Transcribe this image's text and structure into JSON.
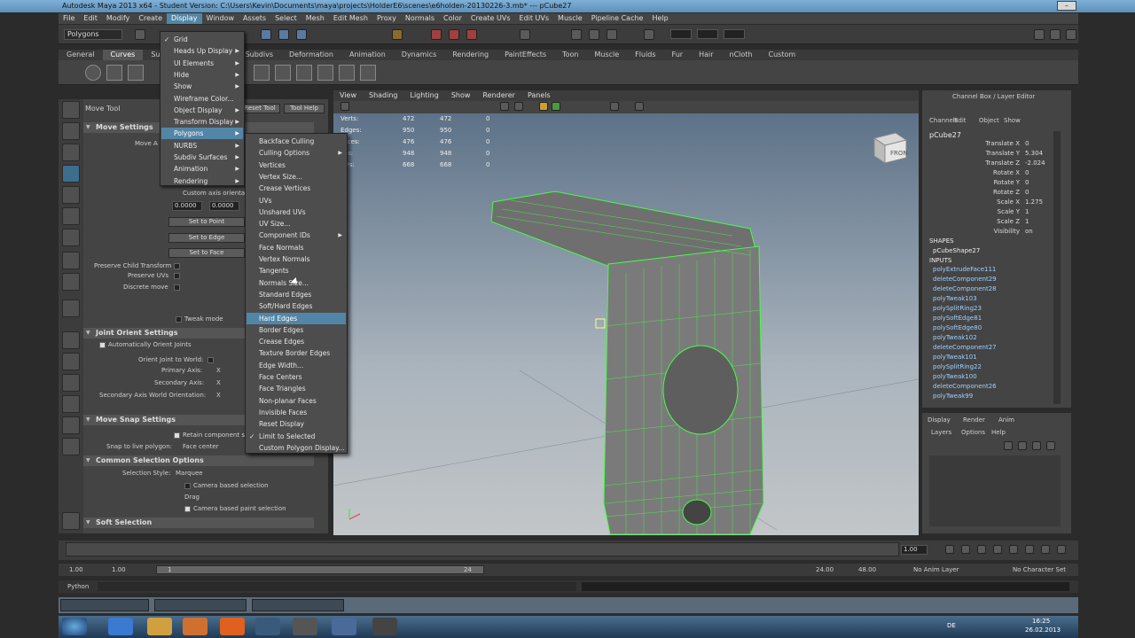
{
  "window": {
    "title": "Autodesk Maya 2013 x64 - Student Version: C:\\Users\\Kevin\\Documents\\maya\\projects\\HolderE6\\scenes\\e6holden-20130226-3.mb* --- pCube27"
  },
  "menubar": [
    "File",
    "Edit",
    "Modify",
    "Create",
    "Display",
    "Window",
    "Assets",
    "Select",
    "Mesh",
    "Edit Mesh",
    "Proxy",
    "Normals",
    "Color",
    "Create UVs",
    "Edit UVs",
    "Muscle",
    "Pipeline Cache",
    "Help"
  ],
  "statusline": {
    "mode": "Polygons"
  },
  "shelf_tabs": [
    "General",
    "Curves",
    "Surfaces",
    "Polygons",
    "Subdivs",
    "Deformation",
    "Animation",
    "Dynamics",
    "Rendering",
    "PaintEffects",
    "Toon",
    "Muscle",
    "Fluids",
    "Fur",
    "Hair",
    "nCloth",
    "Custom"
  ],
  "tool_settings": {
    "title": "Move Tool",
    "tab_reset": "Reset Tool",
    "tab_help": "Tool Help",
    "sections": {
      "move": "Move Settings",
      "joint": "Joint Orient Settings",
      "snap": "Move Snap Settings",
      "common": "Common Selection Options",
      "soft": "Soft Selection"
    },
    "move_label": "Move A",
    "custom_axis": "Custom axis orientat",
    "val1": "0.0000",
    "val2": "0.0000",
    "set_to_point": "Set to Point",
    "set_to_edge": "Set to Edge",
    "set_to_face": "Set to Face",
    "preserve_child": "Preserve Child Transform",
    "preserve_uvs": "Preserve UVs",
    "discrete_move": "Discrete move",
    "tweak_mode": "Tweak mode",
    "auto_orient": "Automatically Orient Joints",
    "orient_world": "Orient Joint to World:",
    "primary_axis": "Primary Axis:",
    "secondary_axis": "Secondary Axis:",
    "secondary_world": "Secondary Axis World Orientation:",
    "axis_x": "X",
    "retain": "Retain component sp",
    "snap_live": "Snap to live polygon:",
    "face_center": "Face center",
    "selection_style": "Selection Style:",
    "marquee": "Marquee",
    "camera_sel": "Camera based selection",
    "drag": "Drag",
    "camera_paint": "Camera based paint selection"
  },
  "display_menu": {
    "items": [
      {
        "label": "Grid",
        "check": true
      },
      {
        "label": "Heads Up Display",
        "sub": true
      },
      {
        "label": "UI Elements",
        "sub": true
      },
      {
        "label": "Hide",
        "sub": true
      },
      {
        "label": "Show",
        "sub": true
      },
      {
        "label": "Wireframe Color..."
      },
      {
        "label": "Object Display",
        "sub": true
      },
      {
        "label": "Transform Display",
        "sub": true
      },
      {
        "label": "Polygons",
        "sub": true,
        "hl": true
      },
      {
        "label": "NURBS",
        "sub": true
      },
      {
        "label": "Subdiv Surfaces",
        "sub": true
      },
      {
        "label": "Animation",
        "sub": true
      },
      {
        "label": "Rendering",
        "sub": true
      }
    ]
  },
  "polygons_menu": {
    "items": [
      {
        "label": "Backface Culling"
      },
      {
        "label": "Culling Options",
        "sub": true
      },
      {
        "label": "Vertices"
      },
      {
        "label": "Vertex Size..."
      },
      {
        "label": "Crease Vertices"
      },
      {
        "label": "UVs"
      },
      {
        "label": "Unshared UVs"
      },
      {
        "label": "UV Size..."
      },
      {
        "label": "Component IDs",
        "sub": true
      },
      {
        "label": "Face Normals"
      },
      {
        "label": "Vertex Normals"
      },
      {
        "label": "Tangents"
      },
      {
        "label": "Normals Size..."
      },
      {
        "label": "Standard Edges"
      },
      {
        "label": "Soft/Hard Edges"
      },
      {
        "label": "Hard Edges",
        "hl": true
      },
      {
        "label": "Border Edges"
      },
      {
        "label": "Crease Edges"
      },
      {
        "label": "Texture Border Edges"
      },
      {
        "label": "Edge Width..."
      },
      {
        "label": "Face Centers"
      },
      {
        "label": "Face Triangles"
      },
      {
        "label": "Non-planar Faces"
      },
      {
        "label": "Invisible Faces"
      },
      {
        "label": "Reset Display"
      },
      {
        "label": "Limit to Selected",
        "check": true
      },
      {
        "label": "Custom Polygon Display..."
      }
    ]
  },
  "viewport": {
    "menu": [
      "View",
      "Shading",
      "Lighting",
      "Show",
      "Renderer",
      "Panels"
    ],
    "hud": [
      {
        "label": "Verts:",
        "a": "472",
        "b": "472",
        "c": "0"
      },
      {
        "label": "Edges:",
        "a": "950",
        "b": "950",
        "c": "0"
      },
      {
        "label": "Faces:",
        "a": "476",
        "b": "476",
        "c": "0"
      },
      {
        "label": "Tris:",
        "a": "948",
        "b": "948",
        "c": "0"
      },
      {
        "label": "UVs:",
        "a": "668",
        "b": "668",
        "c": "0"
      }
    ],
    "viewcube": "FRONT"
  },
  "channel_box": {
    "title": "Channel Box / Layer Editor",
    "menu": [
      "Channels",
      "Edit",
      "Object",
      "Show"
    ],
    "object": "pCube27",
    "attrs": [
      {
        "name": "Translate X",
        "value": "0"
      },
      {
        "name": "Translate Y",
        "value": "5.304"
      },
      {
        "name": "Translate Z",
        "value": "-2.024"
      },
      {
        "name": "Rotate X",
        "value": "0"
      },
      {
        "name": "Rotate Y",
        "value": "0"
      },
      {
        "name": "Rotate Z",
        "value": "0"
      },
      {
        "name": "Scale X",
        "value": "1.275"
      },
      {
        "name": "Scale Y",
        "value": "1"
      },
      {
        "name": "Scale Z",
        "value": "1"
      },
      {
        "name": "Visibility",
        "value": "on"
      }
    ],
    "shapes_label": "SHAPES",
    "shape": "pCubeShape27",
    "inputs_label": "INPUTS",
    "inputs": [
      "polyExtrudeFace111",
      "deleteComponent29",
      "deleteComponent28",
      "polyTweak103",
      "polySplitRing23",
      "polySoftEdge81",
      "polySoftEdge80",
      "polyTweak102",
      "deleteComponent27",
      "polyTweak101",
      "polySplitRing22",
      "polyTweak100",
      "deleteComponent26",
      "polyTweak99"
    ]
  },
  "layer_editor": {
    "tabs": [
      "Display",
      "Render",
      "Anim"
    ],
    "menu": [
      "Layers",
      "Options",
      "Help"
    ]
  },
  "time": {
    "current": "1.00",
    "range_start": "1.00",
    "range_start2": "1.00",
    "range_mark": "1",
    "range_end_mark": "24",
    "range_end": "24.00",
    "range_end2": "48.00",
    "anim_layer": "No Anim Layer",
    "char_set": "No Character Set"
  },
  "cmdline": {
    "label": "Python"
  },
  "taskbar": {
    "lang": "DE",
    "time": "16:25",
    "date": "26.02.2013"
  }
}
